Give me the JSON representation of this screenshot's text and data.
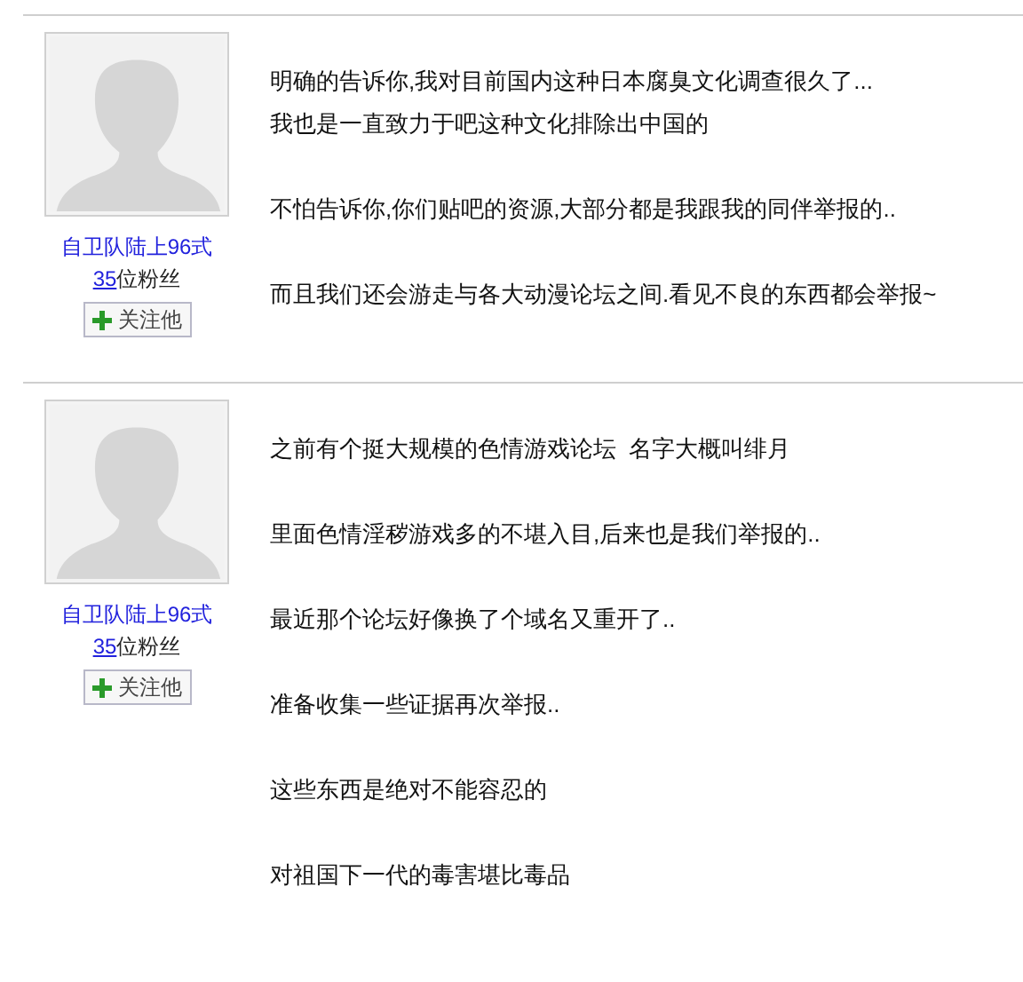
{
  "posts": [
    {
      "author": {
        "name": "自卫队陆上96式",
        "fans_count": "35",
        "fans_label": "位粉丝",
        "follow_button": "关注他"
      },
      "paragraphs": [
        {
          "lines": [
            "明确的告诉你,我对目前国内这种日本腐臭文化调查很久了...",
            "我也是一直致力于吧这种文化排除出中国的"
          ]
        },
        {
          "lines": [
            "不怕告诉你,你们贴吧的资源,大部分都是我跟我的同伴举报的.."
          ]
        },
        {
          "lines": [
            "而且我们还会游走与各大动漫论坛之间.看见不良的东西都会举报~"
          ]
        }
      ]
    },
    {
      "author": {
        "name": "自卫队陆上96式",
        "fans_count": "35",
        "fans_label": "位粉丝",
        "follow_button": "关注他"
      },
      "paragraphs": [
        {
          "lines": [
            "之前有个挺大规模的色情游戏论坛  名字大概叫绯月"
          ]
        },
        {
          "lines": [
            "里面色情淫秽游戏多的不堪入目,后来也是我们举报的.."
          ]
        },
        {
          "lines": [
            "最近那个论坛好像换了个域名又重开了.."
          ]
        },
        {
          "lines": [
            "准备收集一些证据再次举报.."
          ]
        },
        {
          "lines": [
            "这些东西是绝对不能容忍的"
          ]
        },
        {
          "lines": [
            "对祖国下一代的毒害堪比毒品"
          ]
        }
      ]
    }
  ]
}
